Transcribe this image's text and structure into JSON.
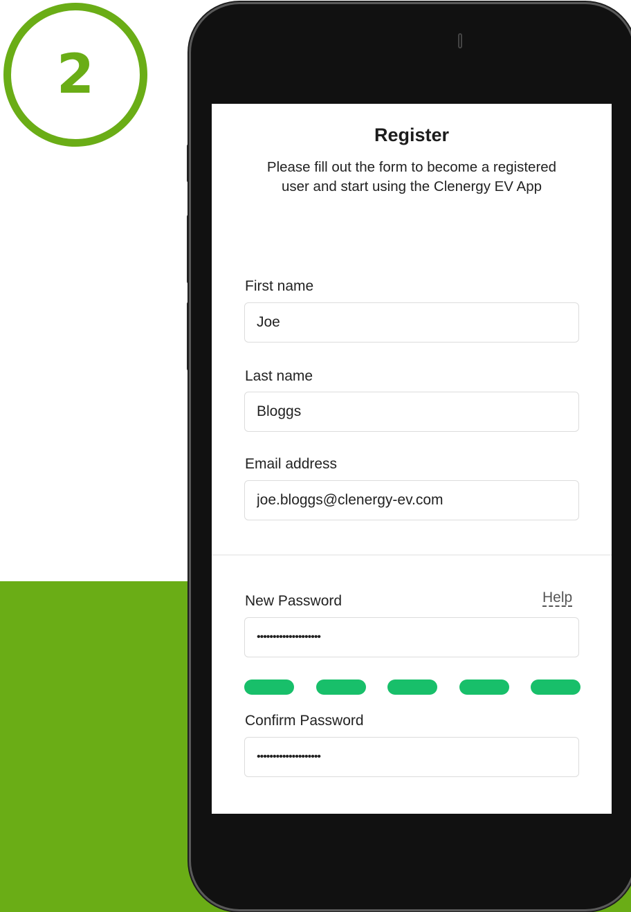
{
  "step": {
    "number": "2"
  },
  "colors": {
    "brand_green": "#6aad16",
    "strength_green": "#18bf6a"
  },
  "form": {
    "title": "Register",
    "subtitle": "Please fill out the form to become a registered user and start using the Clenergy EV App",
    "first_name": {
      "label": "First name",
      "value": "Joe"
    },
    "last_name": {
      "label": "Last name",
      "value": "Bloggs"
    },
    "email": {
      "label": "Email address",
      "value": "joe.bloggs@clenergy-ev.com"
    },
    "new_password": {
      "label": "New Password",
      "help": "Help",
      "value": "********************"
    },
    "password_strength": {
      "filled_segments": 5,
      "total_segments": 5
    },
    "confirm_password": {
      "label": "Confirm Password",
      "value": "********************"
    }
  }
}
